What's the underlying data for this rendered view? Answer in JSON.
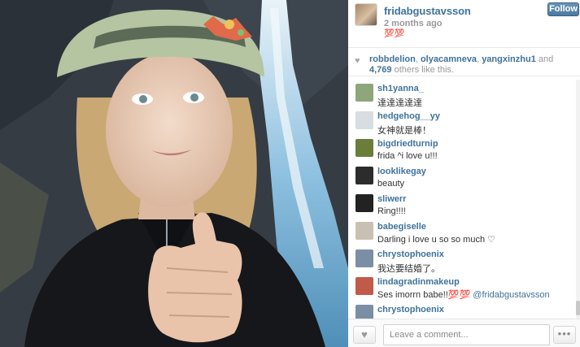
{
  "post": {
    "username": "fridabgustavsson",
    "time_ago": "2 months ago",
    "caption": "💯💯",
    "follow_label": "Follow",
    "photo_subject": "selfie-thumbs-up-waterfall"
  },
  "likes": {
    "icon": "heart-icon",
    "user1": "robbdelion",
    "sep1": ", ",
    "user2": "olyacamneva",
    "sep2": ", ",
    "user3": "yangxinzhu1",
    "and": " and ",
    "count": "4,769",
    "suffix": " others like this."
  },
  "comments": [
    {
      "user": "sh1yanna_",
      "text": "達達達達達",
      "avatar_color": "#8fa67a"
    },
    {
      "user": "hedgehog__yy",
      "text": "女神就是棒！",
      "avatar_color": "#d7dde0"
    },
    {
      "user": "bigdriedturnip",
      "text": "frida ^i love u!!!",
      "avatar_color": "#6a7d3a"
    },
    {
      "user": "looklikegay",
      "text": "beauty",
      "avatar_color": "#2c2c2c"
    },
    {
      "user": "sliwerr",
      "text": "Ring!!!!",
      "avatar_color": "#222222"
    },
    {
      "user": "babegiselle",
      "text": "Darling i love u so so much ♡",
      "avatar_color": "#c9c0b4"
    },
    {
      "user": "chrystophoenix",
      "text": "我达要结婚了。",
      "avatar_color": "#7a8fa6"
    },
    {
      "user": "lindagradinmakeup",
      "text_prefix": "Ses imorrn babe!!💯💯 ",
      "mention": "@fridabgustavsson",
      "avatar_color": "#c25a4a"
    },
    {
      "user": "chrystophoenix",
      "text": "",
      "avatar_color": "#7a8fa6"
    }
  ],
  "footer": {
    "like_icon": "heart-icon",
    "comment_placeholder": "Leave a comment...",
    "more_icon": "ellipsis-icon",
    "more_label": "•••"
  },
  "colors": {
    "link_blue": "#3f729b",
    "muted_text": "#999999",
    "follow_button": "#4b79a1"
  }
}
